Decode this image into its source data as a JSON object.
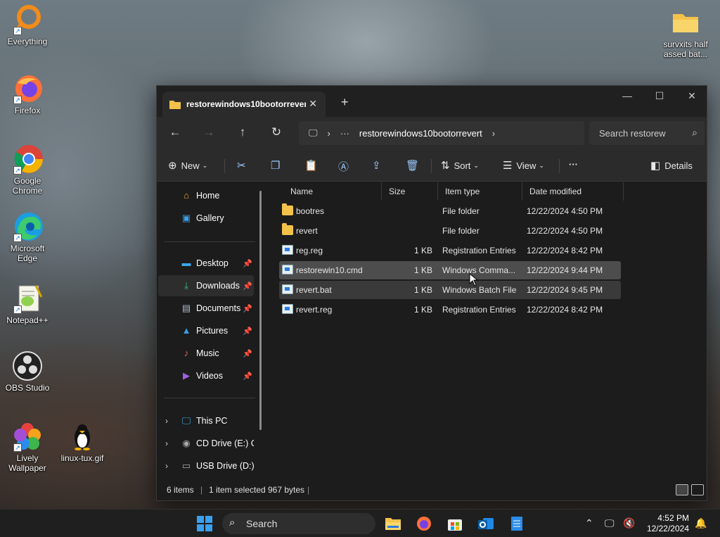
{
  "desktop": {
    "icons": [
      {
        "label": "Everything"
      },
      {
        "label": "Firefox"
      },
      {
        "label": "Google Chrome"
      },
      {
        "label": "Microsoft Edge"
      },
      {
        "label": "Notepad++"
      },
      {
        "label": "OBS Studio"
      },
      {
        "label": "Lively Wallpaper"
      },
      {
        "label": "linux-tux.gif"
      },
      {
        "label": "survxits half assed bat..."
      }
    ]
  },
  "window": {
    "tab_title": "restorewindows10bootorrever",
    "tab_close": "✕",
    "new_tab": "+",
    "controls": {
      "minimize": "—",
      "maximize": "☐",
      "close": "✕"
    }
  },
  "navbar": {
    "back": "←",
    "forward": "→",
    "up": "↑",
    "refresh": "↻",
    "address_chevron": "›",
    "address_more": "···",
    "address_path": "restorewindows10bootorrevert",
    "address_end_chevron": "›",
    "search_placeholder": "Search restorew"
  },
  "toolbar": {
    "new_label": "New",
    "sort_label": "Sort",
    "view_label": "View",
    "more_label": "···",
    "details_label": "Details"
  },
  "sidebar": {
    "home": "Home",
    "gallery": "Gallery",
    "desktop": "Desktop",
    "downloads": "Downloads",
    "documents": "Documents",
    "pictures": "Pictures",
    "music": "Music",
    "videos": "Videos",
    "this_pc": "This PC",
    "cd_drive": "CD Drive (E:) CE",
    "usb_drive": "USB Drive (D:)"
  },
  "columns": {
    "name": "Name",
    "size": "Size",
    "type": "Item type",
    "modified": "Date modified"
  },
  "files": [
    {
      "name": "bootres",
      "size": "",
      "type": "File folder",
      "modified": "12/22/2024 4:50 PM",
      "kind": "folder"
    },
    {
      "name": "revert",
      "size": "",
      "type": "File folder",
      "modified": "12/22/2024 4:50 PM",
      "kind": "folder"
    },
    {
      "name": "reg.reg",
      "size": "1 KB",
      "type": "Registration Entries",
      "modified": "12/22/2024 8:42 PM",
      "kind": "reg"
    },
    {
      "name": "restorewin10.cmd",
      "size": "1 KB",
      "type": "Windows Comma...",
      "modified": "12/22/2024 9:44 PM",
      "kind": "cmd"
    },
    {
      "name": "revert.bat",
      "size": "1 KB",
      "type": "Windows Batch File",
      "modified": "12/22/2024 9:45 PM",
      "kind": "bat"
    },
    {
      "name": "revert.reg",
      "size": "1 KB",
      "type": "Registration Entries",
      "modified": "12/22/2024 8:42 PM",
      "kind": "reg"
    }
  ],
  "status": {
    "count": "6 items",
    "selected": "1 item selected",
    "bytes": "967 bytes"
  },
  "taskbar": {
    "search_label": "Search",
    "time": "4:52 PM",
    "date": "12/22/2024"
  },
  "colors": {
    "accent": "#0078d4",
    "folder": "#f3c24a",
    "window_bg": "#1c1c1c"
  }
}
